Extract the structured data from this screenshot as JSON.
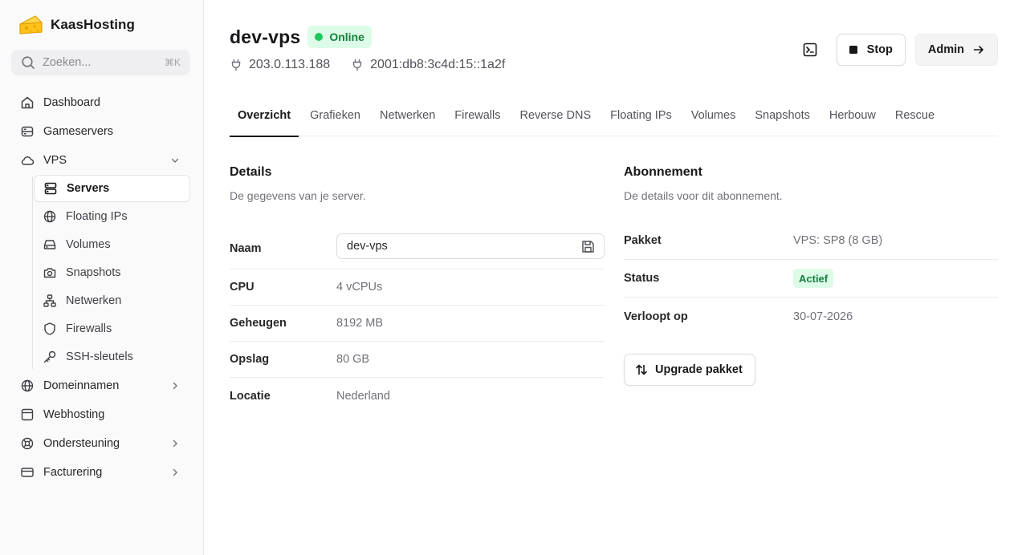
{
  "brand": {
    "name": "KaasHosting",
    "logo_icon": "cheese-icon",
    "accent": "#f5b400"
  },
  "search": {
    "placeholder": "Zoeken...",
    "shortcut": "⌘K"
  },
  "nav": {
    "dashboard": "Dashboard",
    "gameservers": "Gameservers",
    "vps": "VPS",
    "vps_items": {
      "servers": "Servers",
      "floating_ips": "Floating IPs",
      "volumes": "Volumes",
      "snapshots": "Snapshots",
      "netwerken": "Netwerken",
      "firewalls": "Firewalls",
      "ssh": "SSH-sleutels"
    },
    "domeinnamen": "Domeinnamen",
    "webhosting": "Webhosting",
    "ondersteuning": "Ondersteuning",
    "facturering": "Facturering"
  },
  "server": {
    "name": "dev-vps",
    "status": "Online",
    "ipv4": "203.0.113.188",
    "ipv6": "2001:db8:3c4d:15::1a2f"
  },
  "actions": {
    "stop": "Stop",
    "admin": "Admin"
  },
  "tabs": [
    "Overzicht",
    "Grafieken",
    "Netwerken",
    "Firewalls",
    "Reverse DNS",
    "Floating IPs",
    "Volumes",
    "Snapshots",
    "Herbouw",
    "Rescue"
  ],
  "details": {
    "title": "Details",
    "subtitle": "De gegevens van je server.",
    "name_label": "Naam",
    "name_value": "dev-vps",
    "cpu_label": "CPU",
    "cpu_value": "4 vCPUs",
    "memory_label": "Geheugen",
    "memory_value": "8192 MB",
    "storage_label": "Opslag",
    "storage_value": "80 GB",
    "location_label": "Locatie",
    "location_value": "Nederland"
  },
  "subscription": {
    "title": "Abonnement",
    "subtitle": "De details voor dit abonnement.",
    "package_label": "Pakket",
    "package_value": "VPS: SP8 (8 GB)",
    "status_label": "Status",
    "status_value": "Actief",
    "expires_label": "Verloopt op",
    "expires_value": "30-07-2026",
    "upgrade_label": "Upgrade pakket"
  },
  "colors": {
    "online_bg": "#dcfce7",
    "online_text": "#15803d",
    "online_dot": "#22c55e"
  }
}
